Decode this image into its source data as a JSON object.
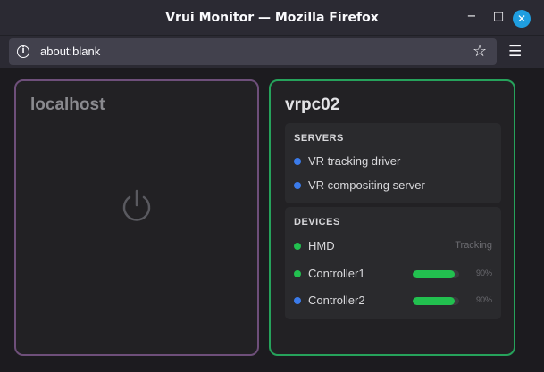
{
  "window": {
    "title": "Vrui Monitor — Mozilla Firefox",
    "controls": {
      "minimize": "−",
      "maximize": "□",
      "close": "✕"
    }
  },
  "navbar": {
    "url": "about:blank",
    "icons": {
      "info": "info-icon",
      "bookmark": "star-icon",
      "menu": "hamburger-menu-icon"
    }
  },
  "colors": {
    "local_border": "#6e4f7a",
    "remote_border": "#26a25b",
    "status_green": "#22c04f",
    "status_blue": "#3b7bea"
  },
  "cards": {
    "local": {
      "name": "localhost",
      "icon": "power-icon"
    },
    "remote": {
      "name": "vrpc02",
      "servers": {
        "heading": "SERVERS",
        "items": [
          {
            "label": "VR tracking driver",
            "status_color": "#3b7bea"
          },
          {
            "label": "VR compositing server",
            "status_color": "#3b7bea"
          }
        ]
      },
      "devices": {
        "heading": "DEVICES",
        "items": [
          {
            "label": "HMD",
            "status_color": "#22c04f",
            "status": "Tracking"
          },
          {
            "label": "Controller1",
            "status_color": "#22c04f",
            "battery": "90%",
            "battery_level": 0.9
          },
          {
            "label": "Controller2",
            "status_color": "#3b7bea",
            "battery": "90%",
            "battery_level": 0.9
          }
        ]
      }
    }
  }
}
